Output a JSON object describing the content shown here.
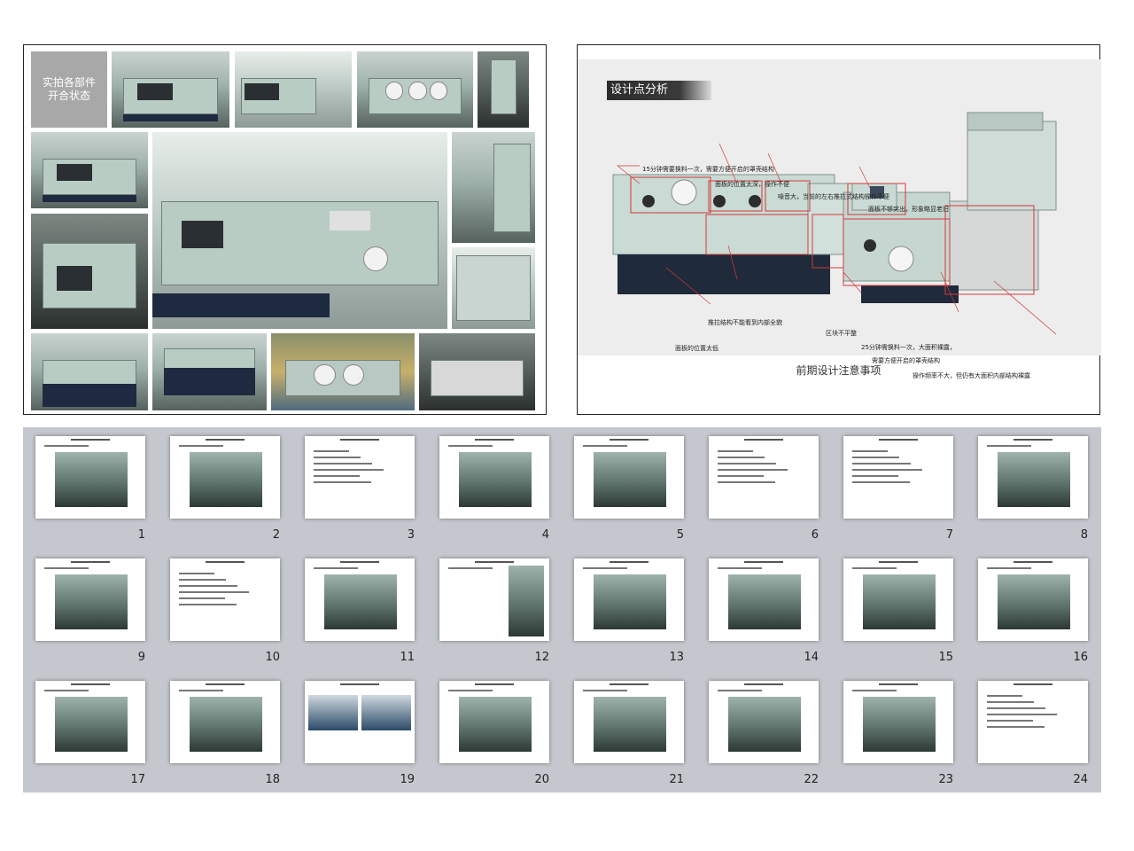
{
  "left_panel": {
    "label": "实拍各部件\n开合状态"
  },
  "right_panel": {
    "title": "设计点分析",
    "caption": "前期设计注意事项",
    "annotations": [
      "15分钟需要换料一次，需要方便开启的罩壳结构",
      "面板的位置太深，操作不便",
      "噪音大，当前的左右推拉式结构操作不便",
      "面板不够突出，形象略显老旧",
      "推拉结构不能看到内部全貌",
      "面板的位置太低",
      "区块不平整",
      "25分钟需换料一次，大面积裸露，",
      "需要方便开启的罩壳结构",
      "操作频率不大，但仍有大面积内部结构裸露"
    ]
  },
  "thumbnails": {
    "numbers": [
      "1",
      "2",
      "3",
      "4",
      "5",
      "6",
      "7",
      "8",
      "9",
      "10",
      "11",
      "12",
      "13",
      "14",
      "15",
      "16",
      "17",
      "18",
      "19",
      "20",
      "21",
      "22",
      "23",
      "24"
    ]
  }
}
